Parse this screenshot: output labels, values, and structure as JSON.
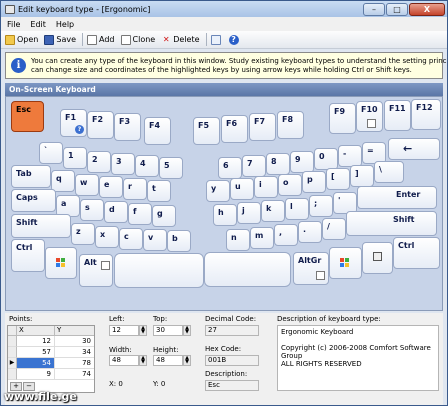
{
  "window": {
    "title": "Edit keyboard type - [Ergonomic]",
    "minimize": "–",
    "maximize": "□",
    "close": "X"
  },
  "menu": [
    "File",
    "Edit",
    "Help"
  ],
  "toolbar": {
    "open": "Open",
    "save": "Save",
    "add": "Add",
    "clone": "Clone",
    "delete": "Delete"
  },
  "info": {
    "line1": "You can create any type of the keyboard in this window. Study existing keyboard types to understand the setting principles. You",
    "line2": "can change size and coordinates of the highlighted keys by using arrow keys while holding Ctrl or Shift keys."
  },
  "keyboard_header": "On-Screen Keyboard",
  "keys": {
    "esc": "Esc",
    "f1": "F1",
    "f2": "F2",
    "f3": "F3",
    "f4": "F4",
    "f5": "F5",
    "f6": "F6",
    "f7": "F7",
    "f8": "F8",
    "f9": "F9",
    "f10": "F10",
    "f11": "F11",
    "f12": "F12",
    "backtick": "`",
    "n1": "1",
    "n2": "2",
    "n3": "3",
    "n4": "4",
    "n5": "5",
    "n6": "6",
    "n7": "7",
    "n8": "8",
    "n9": "9",
    "n0": "0",
    "minus": "-",
    "equals": "=",
    "backspace": "←",
    "tab": "Tab",
    "q": "q",
    "w": "w",
    "e": "e",
    "r": "r",
    "t": "t",
    "y": "y",
    "u": "u",
    "i": "i",
    "o": "o",
    "p": "p",
    "lbracket": "[",
    "rbracket": "]",
    "backslash": "\\",
    "caps": "Caps",
    "a": "a",
    "s": "s",
    "d": "d",
    "f": "f",
    "g": "g",
    "h": "h",
    "j": "j",
    "k": "k",
    "l": "l",
    "semicolon": ";",
    "quote": "'",
    "enter": "Enter",
    "lshift": "Shift",
    "z": "z",
    "x": "x",
    "c": "c",
    "v": "v",
    "b": "b",
    "n": "n",
    "m": "m",
    "comma": ",",
    "period": ".",
    "slash": "/",
    "rshift": "Shift",
    "lctrl": "Ctrl",
    "alt": "Alt",
    "altgr": "AltGr",
    "rctrl": "Ctrl"
  },
  "points": {
    "label": "Points:",
    "headers": [
      "X",
      "Y"
    ],
    "rows": [
      [
        "12",
        "30"
      ],
      [
        "57",
        "34"
      ],
      [
        "54",
        "78"
      ],
      [
        "9",
        "74"
      ]
    ],
    "add": "+",
    "remove": "−"
  },
  "fields": {
    "left_label": "Left:",
    "left": "12",
    "top_label": "Top:",
    "top": "30",
    "width_label": "Width:",
    "width": "48",
    "height_label": "Height:",
    "height": "48",
    "x_readout": "X: 0",
    "y_readout": "Y: 0",
    "decimal_label": "Decimal Code:",
    "decimal": "27",
    "hex_label": "Hex Code:",
    "hex": "001B",
    "desc_label": "Description:",
    "desc": "Esc"
  },
  "description": {
    "label": "Description of keyboard type:",
    "text": "Ergonomic Keyboard\n\nCopyright (c) 2006-2008  Comfort Software Group\nALL RIGHTS RESERVED"
  },
  "watermark": "www.file.ge"
}
